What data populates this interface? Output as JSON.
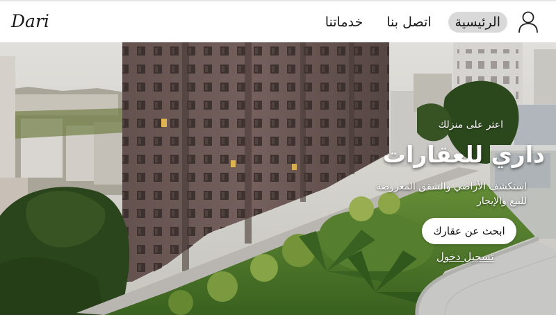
{
  "header": {
    "brand": "Dari",
    "nav": [
      {
        "label": "الرئيسية",
        "active": true
      },
      {
        "label": "اتصل بنا",
        "active": false
      },
      {
        "label": "خدماتنا",
        "active": false
      }
    ],
    "user_icon": "user-icon"
  },
  "hero": {
    "tagline": "اعثر على منزلك",
    "title": "داري للعقارات",
    "description": "استكشف الأراضي والشقق المعروضة للبيع والإيجار",
    "search_button": "ابحث عن عقارك",
    "login_link": "تسجيل دخول"
  },
  "colors": {
    "active_nav_bg": "#d9d9d9",
    "hero_text": "#ffffff",
    "button_bg": "#ffffff"
  }
}
